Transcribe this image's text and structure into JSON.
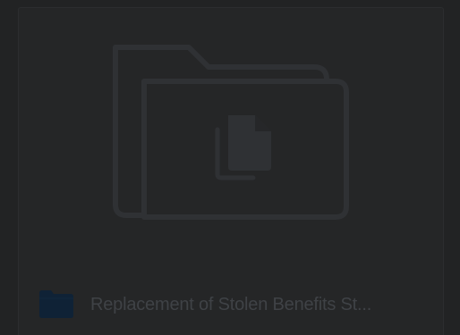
{
  "item": {
    "name": "Replacement of Stolen Benefits St...",
    "type_icon": "folder-icon",
    "thumbnail_icon": "folder-with-document-icon"
  },
  "colors": {
    "background": "#222324",
    "card": "#252627",
    "thumbnail_stroke": "#2f3134",
    "folder_icon": "#0f2236",
    "text": "#3f4246"
  }
}
